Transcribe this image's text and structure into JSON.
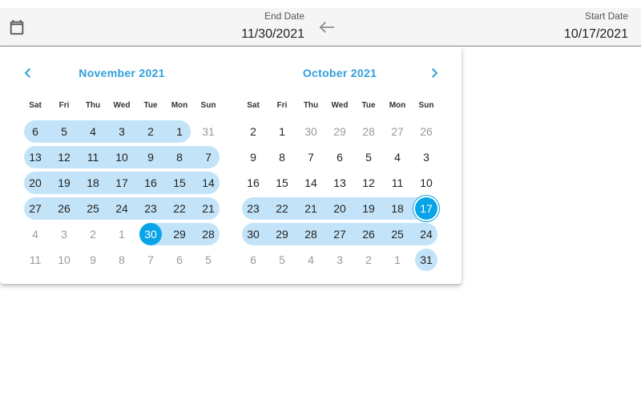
{
  "header": {
    "end_label": "End Date",
    "end_value": "11/30/2021",
    "start_label": "Start Date",
    "start_value": "10/17/2021",
    "icons": [
      "calendar-icon",
      "arrow-left-icon"
    ]
  },
  "colors": {
    "accent": "#2f9fdc",
    "selected": "#08a4e8",
    "range": "#c3e4f8"
  },
  "weekdays": [
    "Sat",
    "Fri",
    "Thu",
    "Wed",
    "Tue",
    "Mon",
    "Sun"
  ],
  "months": [
    {
      "title": "November 2021",
      "rows": [
        {
          "days": [
            "6",
            "5",
            "4",
            "3",
            "2",
            "1",
            "31"
          ],
          "out": [
            6
          ],
          "band": [
            0,
            5
          ]
        },
        {
          "days": [
            "13",
            "12",
            "11",
            "10",
            "9",
            "8",
            "7"
          ],
          "out": [],
          "band": [
            0,
            6
          ]
        },
        {
          "days": [
            "20",
            "19",
            "18",
            "17",
            "16",
            "15",
            "14"
          ],
          "out": [],
          "band": [
            0,
            6
          ]
        },
        {
          "days": [
            "27",
            "26",
            "25",
            "24",
            "23",
            "22",
            "21"
          ],
          "out": [],
          "band": [
            0,
            6
          ]
        },
        {
          "days": [
            "4",
            "3",
            "2",
            "1",
            "30",
            "29",
            "28"
          ],
          "out": [
            0,
            1,
            2,
            3
          ],
          "band": [
            4,
            6
          ],
          "selected": 4
        },
        {
          "days": [
            "11",
            "10",
            "9",
            "8",
            "7",
            "6",
            "5"
          ],
          "out": [
            0,
            1,
            2,
            3,
            4,
            5,
            6
          ]
        }
      ]
    },
    {
      "title": "October 2021",
      "rows": [
        {
          "days": [
            "2",
            "1",
            "30",
            "29",
            "28",
            "27",
            "26"
          ],
          "out": [
            2,
            3,
            4,
            5,
            6
          ]
        },
        {
          "days": [
            "9",
            "8",
            "7",
            "6",
            "5",
            "4",
            "3"
          ],
          "out": []
        },
        {
          "days": [
            "16",
            "15",
            "14",
            "13",
            "12",
            "11",
            "10"
          ],
          "out": []
        },
        {
          "days": [
            "23",
            "22",
            "21",
            "20",
            "19",
            "18",
            "17"
          ],
          "out": [],
          "band": [
            0,
            6
          ],
          "selected": 6
        },
        {
          "days": [
            "30",
            "29",
            "28",
            "27",
            "26",
            "25",
            "24"
          ],
          "out": [],
          "band": [
            0,
            6
          ]
        },
        {
          "days": [
            "6",
            "5",
            "4",
            "3",
            "2",
            "1",
            "31"
          ],
          "out": [
            0,
            1,
            2,
            3,
            4,
            5
          ],
          "band": [
            6,
            6
          ]
        }
      ]
    }
  ]
}
